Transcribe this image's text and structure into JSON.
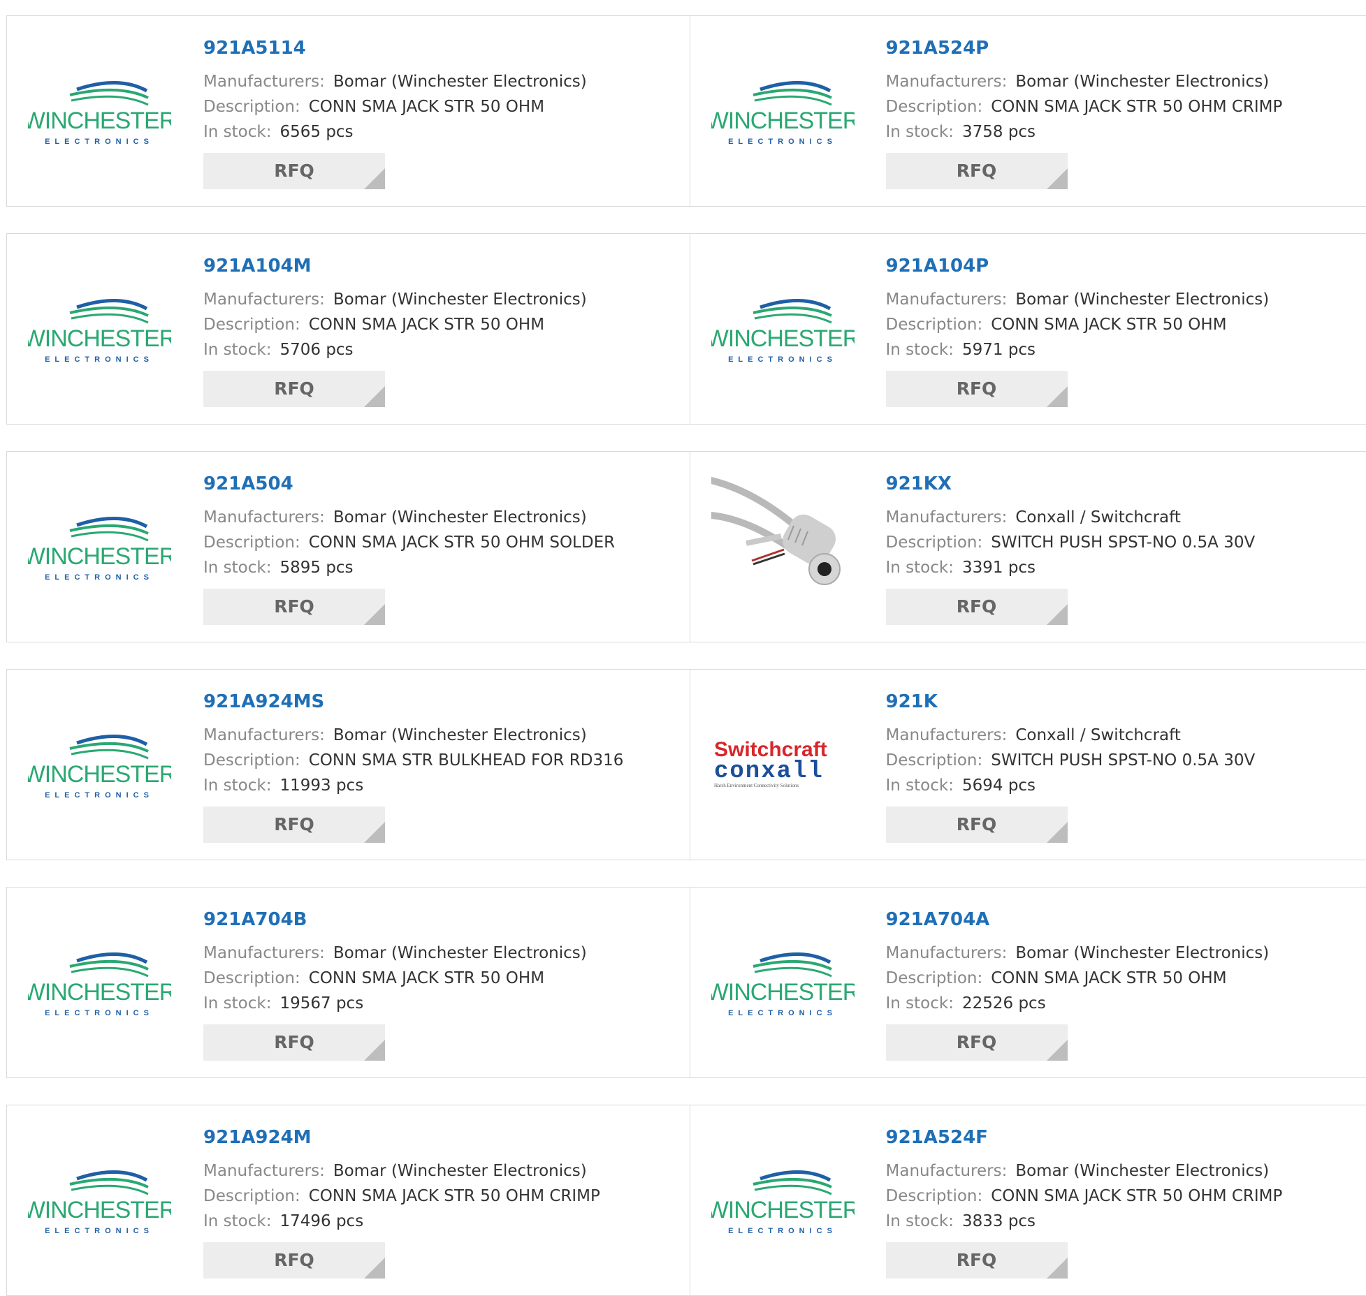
{
  "labels": {
    "manufacturers": "Manufacturers:",
    "description": "Description:",
    "in_stock": "In stock:",
    "rfq": "RFQ"
  },
  "logos": {
    "winchester_word": "WINCHESTER",
    "winchester_sub": "ELECTRONICS",
    "switchcraft_word": "Switchcraft",
    "conxall_word": "conxall",
    "conxall_tagline": "Harsh Environment Connectivity Solutions"
  },
  "colors": {
    "part_link": "#1f6fb6",
    "winchester_green": "#2aa872",
    "winchester_blue": "#1f5fa6",
    "switchcraft_red": "#d8262b",
    "conxall_blue": "#1b4f9c"
  },
  "rows": [
    [
      {
        "part": "921A5114",
        "manufacturer": "Bomar (Winchester Electronics)",
        "description": "CONN SMA JACK STR 50 OHM",
        "stock": "6565 pcs",
        "logo": "winchester"
      },
      {
        "part": "921A524P",
        "manufacturer": "Bomar (Winchester Electronics)",
        "description": "CONN SMA JACK STR 50 OHM CRIMP",
        "stock": "3758 pcs",
        "logo": "winchester"
      }
    ],
    [
      {
        "part": "921A104M",
        "manufacturer": "Bomar (Winchester Electronics)",
        "description": "CONN SMA JACK STR 50 OHM",
        "stock": "5706 pcs",
        "logo": "winchester"
      },
      {
        "part": "921A104P",
        "manufacturer": "Bomar (Winchester Electronics)",
        "description": "CONN SMA JACK STR 50 OHM",
        "stock": "5971 pcs",
        "logo": "winchester"
      }
    ],
    [
      {
        "part": "921A504",
        "manufacturer": "Bomar (Winchester Electronics)",
        "description": "CONN SMA JACK STR 50 OHM SOLDER",
        "stock": "5895 pcs",
        "logo": "winchester"
      },
      {
        "part": "921KX",
        "manufacturer": "Conxall / Switchcraft",
        "description": "SWITCH PUSH SPST-NO 0.5A 30V",
        "stock": "3391 pcs",
        "logo": "cable-photo"
      }
    ],
    [
      {
        "part": "921A924MS",
        "manufacturer": "Bomar (Winchester Electronics)",
        "description": "CONN SMA STR BULKHEAD FOR RD316",
        "stock": "11993 pcs",
        "logo": "winchester"
      },
      {
        "part": "921K",
        "manufacturer": "Conxall / Switchcraft",
        "description": "SWITCH PUSH SPST-NO 0.5A 30V",
        "stock": "5694 pcs",
        "logo": "switchcraft"
      }
    ],
    [
      {
        "part": "921A704B",
        "manufacturer": "Bomar (Winchester Electronics)",
        "description": "CONN SMA JACK STR 50 OHM",
        "stock": "19567 pcs",
        "logo": "winchester"
      },
      {
        "part": "921A704A",
        "manufacturer": "Bomar (Winchester Electronics)",
        "description": "CONN SMA JACK STR 50 OHM",
        "stock": "22526 pcs",
        "logo": "winchester"
      }
    ],
    [
      {
        "part": "921A924M",
        "manufacturer": "Bomar (Winchester Electronics)",
        "description": "CONN SMA JACK STR 50 OHM CRIMP",
        "stock": "17496 pcs",
        "logo": "winchester"
      },
      {
        "part": "921A524F",
        "manufacturer": "Bomar (Winchester Electronics)",
        "description": "CONN SMA JACK STR 50 OHM CRIMP",
        "stock": "3833 pcs",
        "logo": "winchester"
      }
    ]
  ]
}
